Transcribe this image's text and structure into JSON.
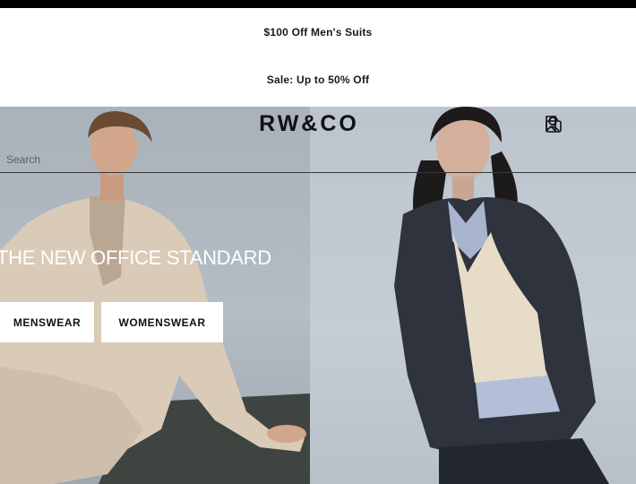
{
  "promos": [
    "$100 Off Men's Suits",
    "Sale: Up to 50% Off"
  ],
  "header": {
    "logo": "RW&CO",
    "search_placeholder": "Search",
    "icons": [
      "account-icon",
      "wishlist-bookmark-icon",
      "shopping-bag-icon"
    ]
  },
  "hero": {
    "headline": "THE NEW OFFICE STANDARD",
    "buttons": {
      "menswear": "MENSWEAR",
      "womenswear": "WOMENSWEAR"
    }
  }
}
